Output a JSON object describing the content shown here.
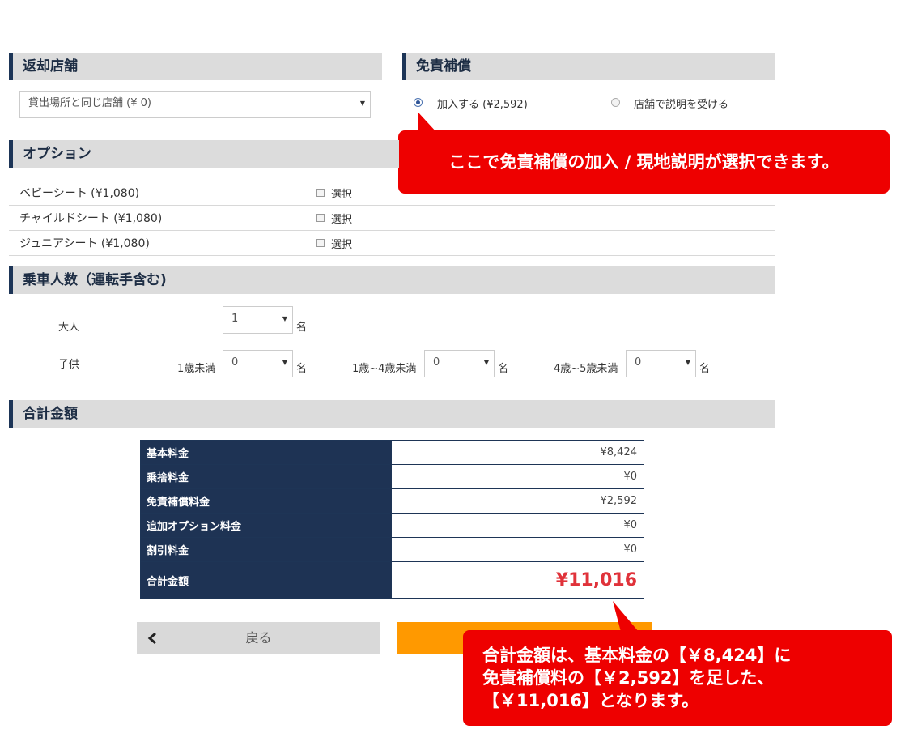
{
  "return_store": {
    "header": "返却店舗",
    "select_value": "貸出場所と同じ店舗 (¥ 0)"
  },
  "insurance": {
    "header": "免責補償",
    "option_join": "加入する (¥2,592)",
    "option_explain": "店舗で説明を受ける",
    "selected": "join"
  },
  "callout_top": "ここで免責補償の加入 / 現地説明が選択できます。",
  "options": {
    "header": "オプション",
    "check_label": "選択",
    "items": [
      {
        "label": "ベビーシート (¥1,080)"
      },
      {
        "label": "チャイルドシート (¥1,080)"
      },
      {
        "label": "ジュニアシート (¥1,080)"
      }
    ]
  },
  "passengers": {
    "header": "乗車人数（運転手含む)",
    "adult_label": "大人",
    "adult_value": "1",
    "child_label": "子供",
    "unit": "名",
    "child_groups": [
      {
        "label": "1歳未満",
        "value": "0"
      },
      {
        "label": "1歳~4歳未満",
        "value": "0"
      },
      {
        "label": "4歳~5歳未満",
        "value": "0"
      }
    ]
  },
  "total": {
    "header": "合計金額",
    "rows": [
      {
        "label": "基本料金",
        "value": "¥8,424"
      },
      {
        "label": "乗捨料金",
        "value": "¥0"
      },
      {
        "label": "免責補償料金",
        "value": "¥2,592"
      },
      {
        "label": "追加オプション料金",
        "value": "¥0"
      },
      {
        "label": "割引料金",
        "value": "¥0"
      }
    ],
    "grand_label": "合計金額",
    "grand_value": "¥11,016"
  },
  "buttons": {
    "back_label": "戻る",
    "back_icon": "chevron-left-icon"
  },
  "callout_bottom": {
    "line1": "合計金額は、基本料金の【￥8,424】に",
    "line2": "免責補償料の【￥2,592】を足した、",
    "line3": "【￥11,016】となります。"
  },
  "colors": {
    "header_bg": "#dcdcdc",
    "header_accent": "#1d3557",
    "table_key_bg": "#1e3354",
    "grand_total": "#e0323a",
    "callout": "#ee0000",
    "next_button": "#ff9900",
    "back_button": "#d9d9d9"
  }
}
